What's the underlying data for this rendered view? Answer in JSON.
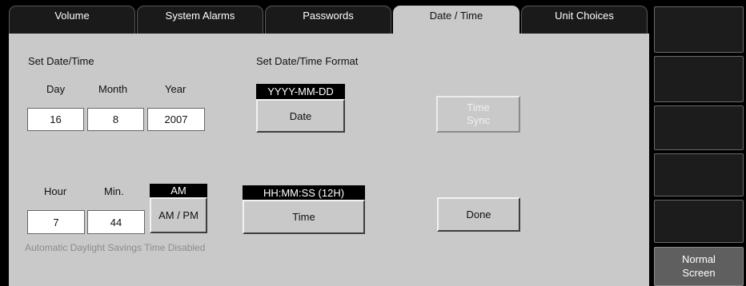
{
  "tabs": [
    {
      "label": "Volume",
      "active": false
    },
    {
      "label": "System Alarms",
      "active": false
    },
    {
      "label": "Passwords",
      "active": false
    },
    {
      "label": "Date / Time",
      "active": true
    },
    {
      "label": "Unit Choices",
      "active": false
    }
  ],
  "date_section": {
    "title": "Set Date/Time",
    "day_label": "Day",
    "month_label": "Month",
    "year_label": "Year",
    "day_value": "16",
    "month_value": "8",
    "year_value": "2007"
  },
  "format_section": {
    "title": "Set Date/Time Format",
    "date_format_value": "YYYY-MM-DD",
    "date_button_label": "Date",
    "time_format_value": "HH:MM:SS (12H)",
    "time_button_label": "Time"
  },
  "time_section": {
    "hour_label": "Hour",
    "min_label": "Min.",
    "hour_value": "7",
    "min_value": "44",
    "ampm_value": "AM",
    "ampm_button_label": "AM / PM"
  },
  "time_sync": {
    "line1": "Time",
    "line2": "Sync",
    "enabled": false
  },
  "done_label": "Done",
  "dst_note": "Automatic Daylight Savings Time Disabled",
  "sidebar": {
    "normal_screen_line1": "Normal",
    "normal_screen_line2": "Screen"
  },
  "colors": {
    "panel": "#c9c9c9",
    "background": "#000000",
    "disabled_text": "#f1f1f1"
  }
}
